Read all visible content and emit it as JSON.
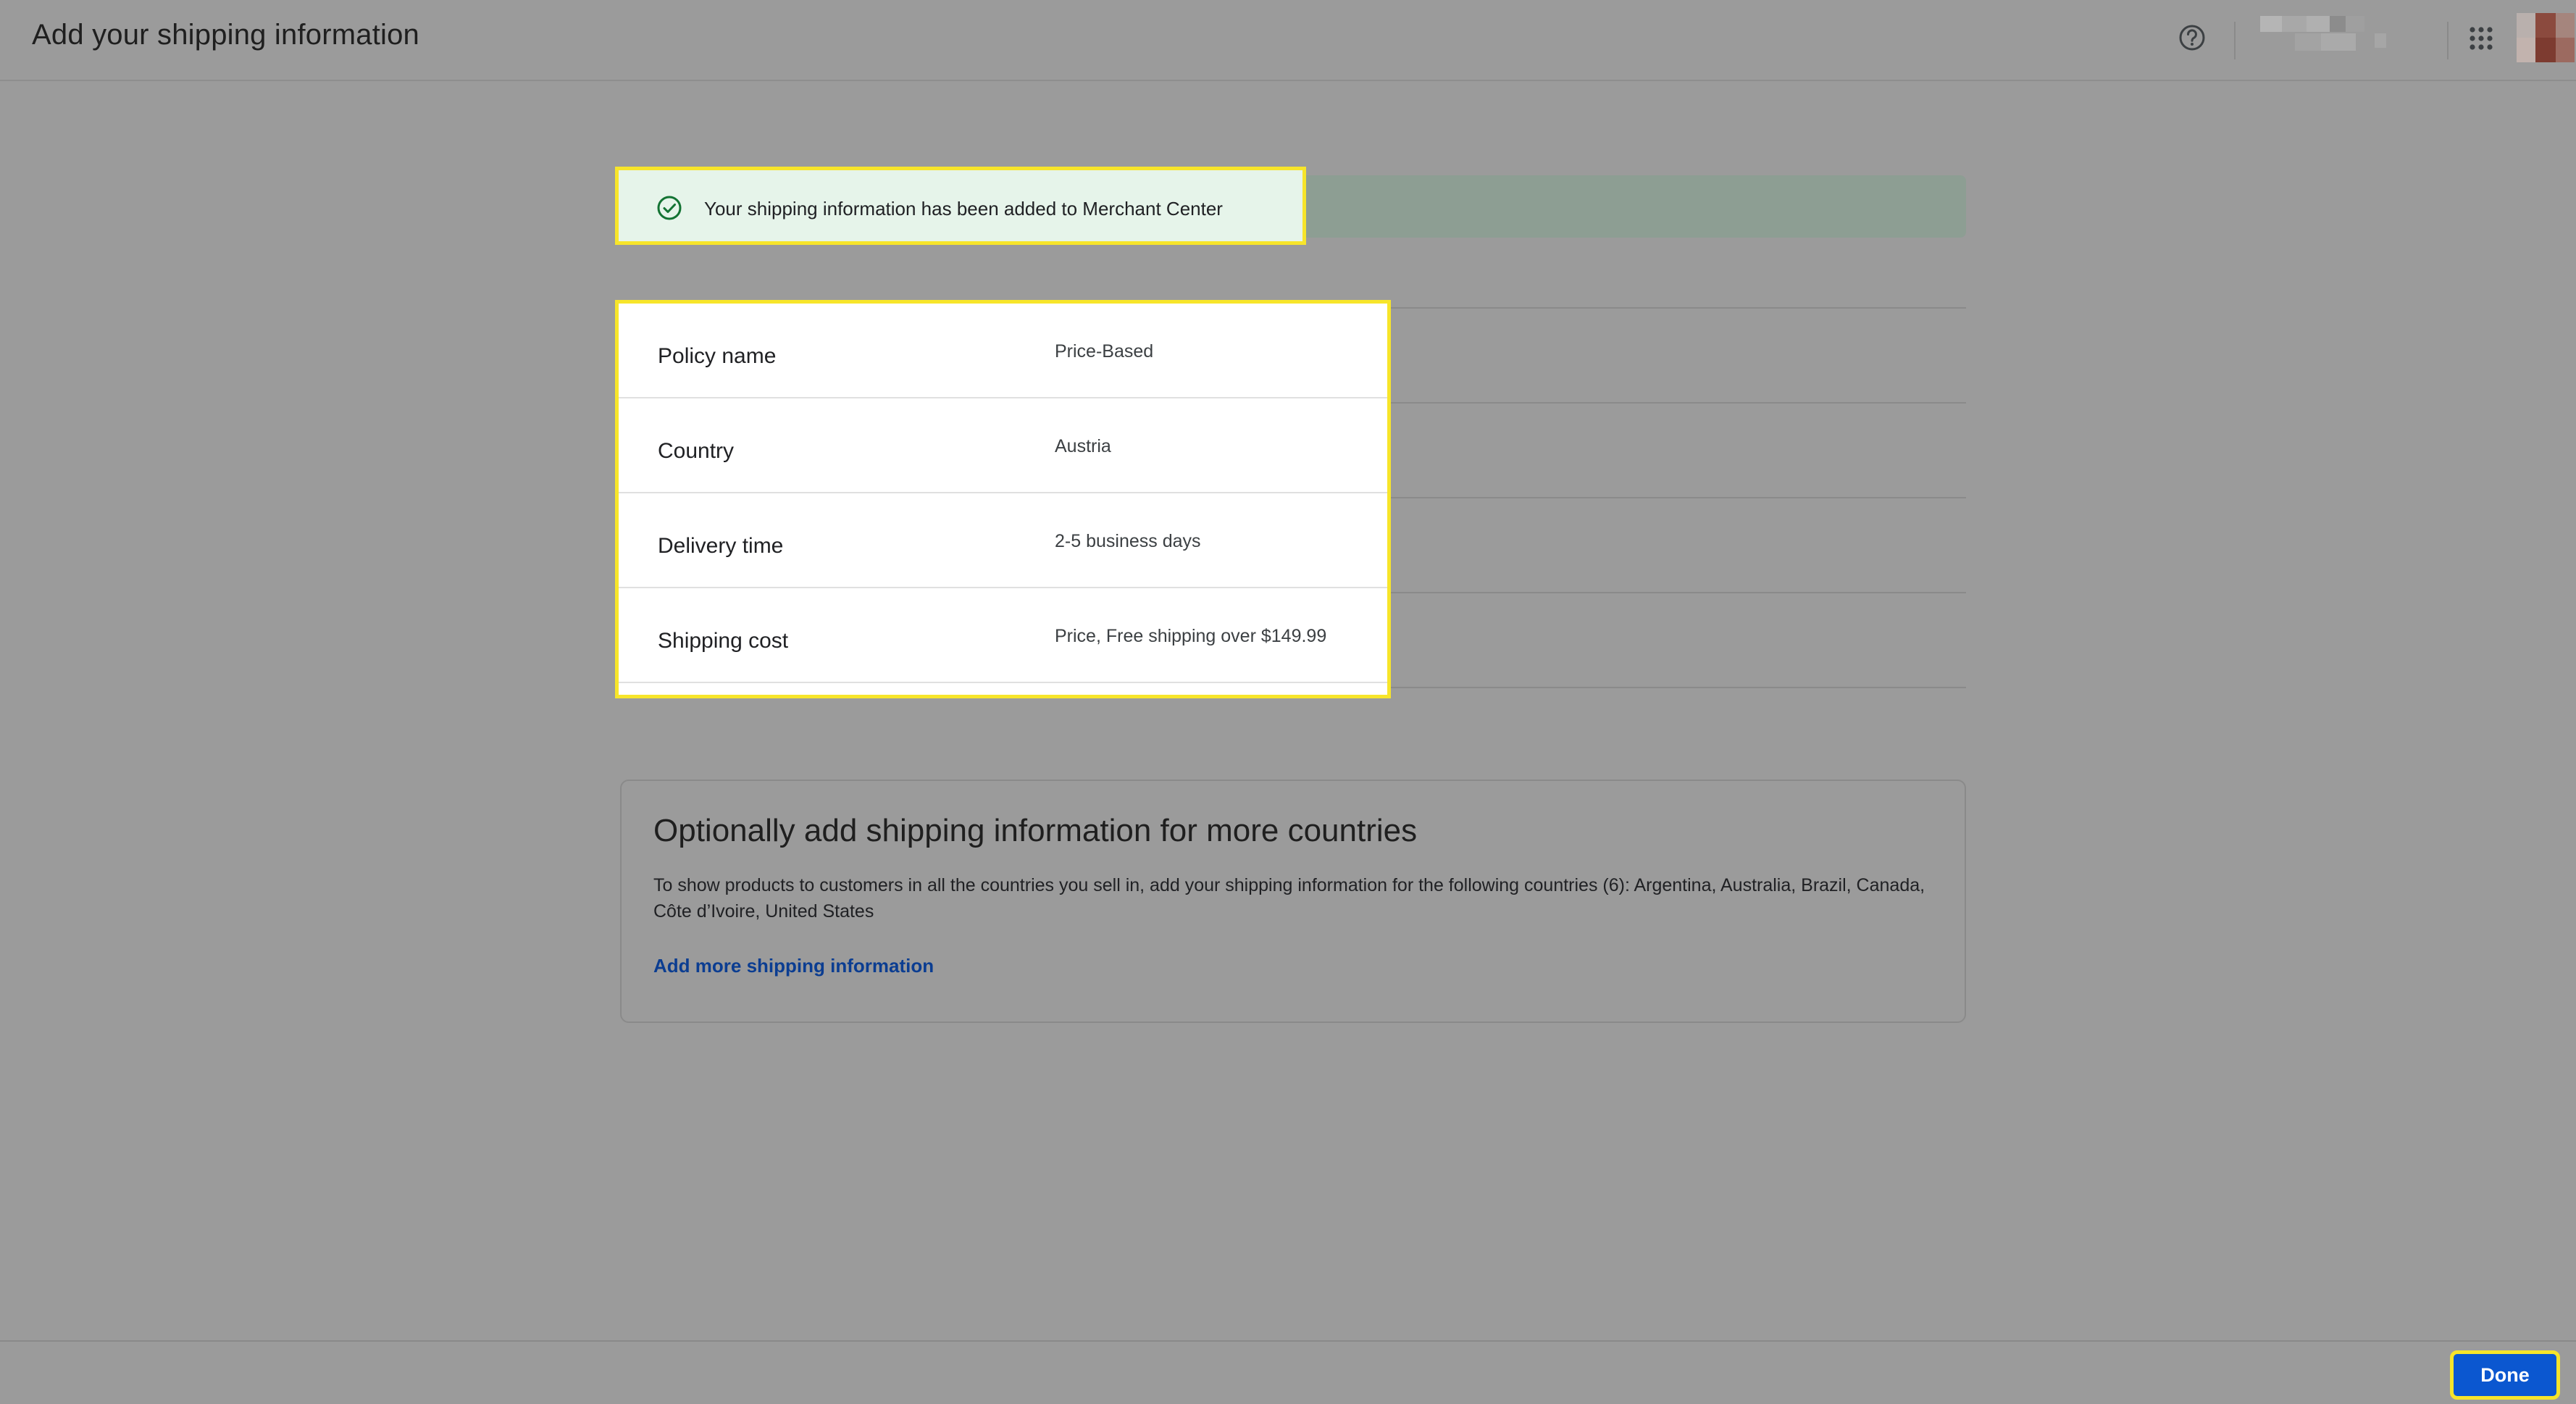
{
  "header": {
    "title": "Add your shipping information",
    "help_icon": "help-circle-icon",
    "apps_icon": "apps-grid-icon"
  },
  "banner": {
    "icon": "check-circle-icon",
    "message": "Your shipping information has been added to Merchant Center"
  },
  "policy": {
    "rows": [
      {
        "label": "Policy name",
        "value": "Price-Based"
      },
      {
        "label": "Country",
        "value": "Austria"
      },
      {
        "label": "Delivery time",
        "value": "2-5 business days"
      },
      {
        "label": "Shipping cost",
        "value": "Price, Free shipping over $149.99"
      }
    ]
  },
  "optional": {
    "title": "Optionally add shipping information for more countries",
    "description": "To show products to customers in all the countries you sell in, add your shipping information for the following countries (6): Argentina, Australia, Brazil, Canada, Côte d’Ivoire, United States",
    "link": "Add more shipping information"
  },
  "footer": {
    "done_label": "Done"
  },
  "colors": {
    "highlight": "#f7e52a",
    "success": "#137333",
    "primary_button": "#0b57d0",
    "link": "#0b3d91"
  }
}
